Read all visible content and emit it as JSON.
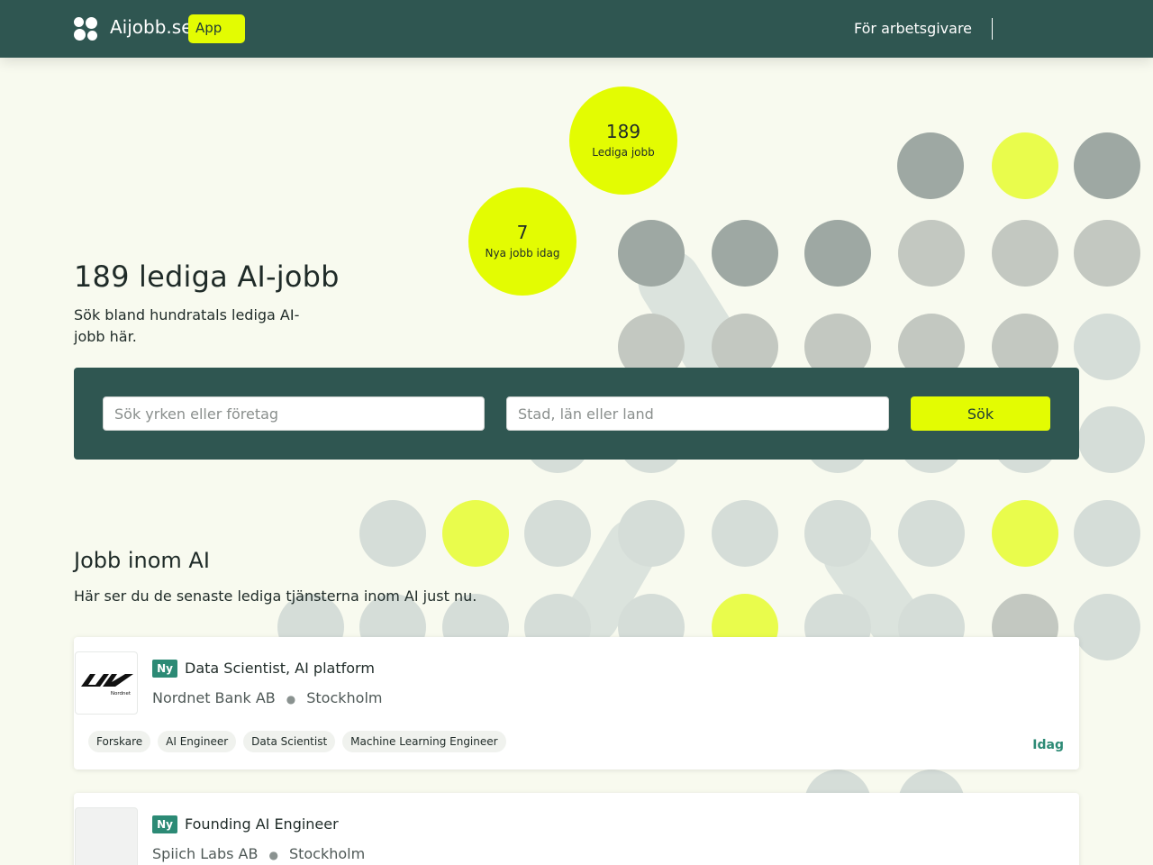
{
  "header": {
    "brand": "Aijobb.se",
    "app_badge": "App",
    "employer_link": "För arbetsgivare"
  },
  "stats": {
    "open_jobs_count": "189",
    "open_jobs_label": "Lediga jobb",
    "new_today_count": "7",
    "new_today_label": "Nya jobb idag"
  },
  "hero": {
    "title": "189 lediga AI-jobb",
    "subtitle": "Sök bland hundratals lediga AI-jobb här."
  },
  "search": {
    "query_placeholder": "Sök yrken eller företag",
    "location_placeholder": "Stad, län eller land",
    "submit_label": "Sök"
  },
  "section": {
    "title": "Jobb inom AI",
    "subtitle": "Här ser du de senaste lediga tjänsterna inom AI just nu."
  },
  "jobs": [
    {
      "badge": "Ny",
      "title": "Data Scientist, AI platform",
      "company": "Nordnet Bank AB",
      "location": "Stockholm",
      "logo_text": "Nordnet",
      "tags": [
        "Forskare",
        "AI Engineer",
        "Data Scientist",
        "Machine Learning Engineer"
      ],
      "date": "Idag"
    },
    {
      "badge": "Ny",
      "title": "Founding AI Engineer",
      "company": "Spiich Labs AB",
      "location": "Stockholm"
    }
  ],
  "colors": {
    "primary": "#2f5651",
    "accent": "#e3fc02",
    "background": "#f8faef",
    "badge_green": "#2c8a75"
  }
}
